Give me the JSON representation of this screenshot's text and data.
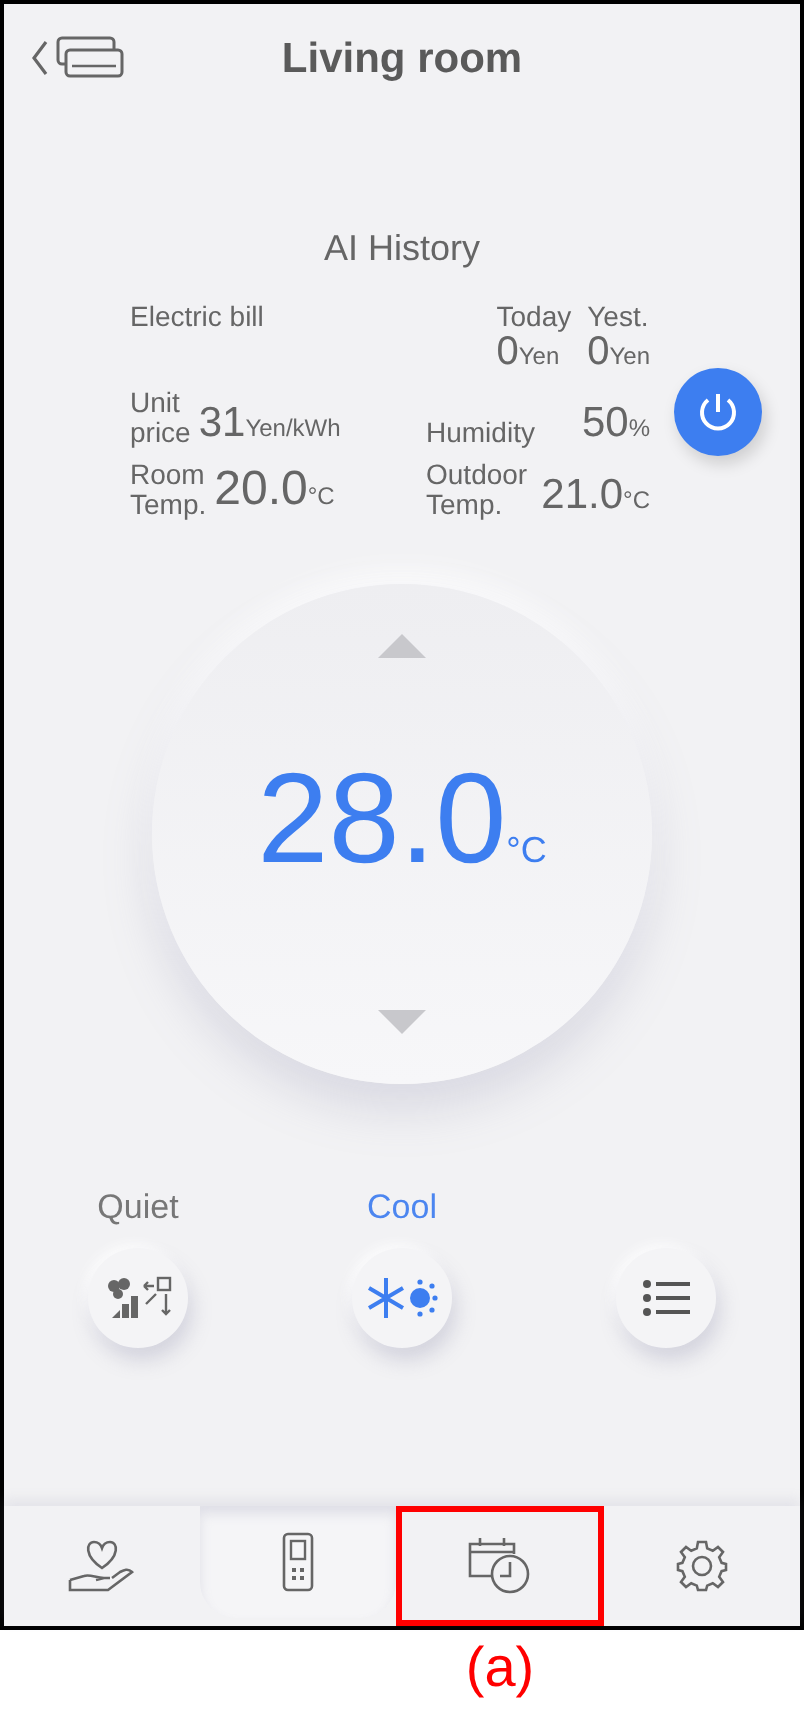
{
  "header": {
    "title": "Living room"
  },
  "ai_history": {
    "title": "AI History"
  },
  "electric_bill": {
    "label": "Electric bill",
    "today": {
      "label": "Today",
      "value": "0",
      "unit": "Yen"
    },
    "yesterday": {
      "label": "Yest.",
      "value": "0",
      "unit": "Yen"
    }
  },
  "unit_price": {
    "label": "Unit price",
    "value": "31",
    "unit": "Yen/kWh"
  },
  "humidity": {
    "label": "Humidity",
    "value": "50",
    "unit": "%"
  },
  "room_temp": {
    "label": "Room Temp.",
    "value": "20.0",
    "unit": "°C"
  },
  "outdoor_temp": {
    "label": "Outdoor Temp.",
    "value": "21.0",
    "unit": "°C"
  },
  "power": {
    "on": true
  },
  "setpoint": {
    "value": "28.0",
    "unit": "°C"
  },
  "modes": [
    {
      "kind": "fan",
      "label": "Quiet",
      "active": false
    },
    {
      "kind": "cool",
      "label": "Cool",
      "active": true
    },
    {
      "kind": "menu"
    }
  ],
  "tabs": [
    {
      "kind": "care",
      "selected": false,
      "annotated": false
    },
    {
      "kind": "remote",
      "selected": true,
      "annotated": false
    },
    {
      "kind": "schedule",
      "selected": false,
      "annotated": true
    },
    {
      "kind": "settings",
      "selected": false,
      "annotated": false
    }
  ],
  "annotation": {
    "label": "(a)"
  }
}
